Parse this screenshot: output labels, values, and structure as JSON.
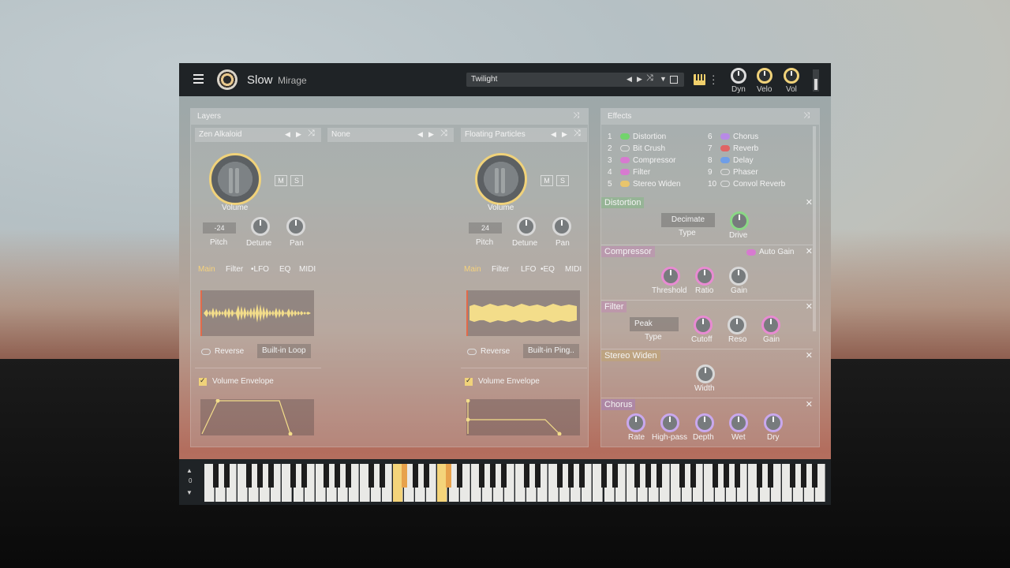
{
  "header": {
    "title": "Slow",
    "subtitle": "Mirage",
    "preset": "Twilight",
    "knobs": [
      {
        "label": "Dyn"
      },
      {
        "label": "Velo"
      },
      {
        "label": "Vol"
      }
    ]
  },
  "layers_panel": {
    "title": "Layers",
    "layers": [
      {
        "name": "Zen Alkaloid",
        "volume_label": "Volume",
        "mute": "M",
        "solo": "S",
        "pitch_value": "-24",
        "pitch_label": "Pitch",
        "detune_label": "Detune",
        "pan_label": "Pan",
        "tabs": [
          "Main",
          "Filter",
          "•LFO",
          "EQ",
          "MIDI"
        ],
        "reverse_label": "Reverse",
        "loop_mode": "Built-in Loop",
        "envelope_label": "Volume Envelope"
      },
      {
        "name": "None"
      },
      {
        "name": "Floating Particles",
        "volume_label": "Volume",
        "mute": "M",
        "solo": "S",
        "pitch_value": "24",
        "pitch_label": "Pitch",
        "detune_label": "Detune",
        "pan_label": "Pan",
        "tabs": [
          "Main",
          "Filter",
          "LFO",
          "•EQ",
          "MIDI"
        ],
        "reverse_label": "Reverse",
        "loop_mode": "Built-in Ping..",
        "envelope_label": "Volume Envelope"
      }
    ]
  },
  "effects_panel": {
    "title": "Effects",
    "list_left": [
      {
        "num": "1",
        "name": "Distortion",
        "color": "#72d46c",
        "on": true
      },
      {
        "num": "2",
        "name": "Bit Crush",
        "color": "#dddddd",
        "on": false
      },
      {
        "num": "3",
        "name": "Compressor",
        "color": "#d77ad0",
        "on": true
      },
      {
        "num": "4",
        "name": "Filter",
        "color": "#d77ad0",
        "on": true
      },
      {
        "num": "5",
        "name": "Stereo Widen",
        "color": "#e9c56c",
        "on": true
      }
    ],
    "list_right": [
      {
        "num": "6",
        "name": "Chorus",
        "color": "#b88ae6",
        "on": true
      },
      {
        "num": "7",
        "name": "Reverb",
        "color": "#e06464",
        "on": true
      },
      {
        "num": "8",
        "name": "Delay",
        "color": "#6f9ee8",
        "on": true
      },
      {
        "num": "9",
        "name": "Phaser",
        "color": "#dddddd",
        "on": false
      },
      {
        "num": "10",
        "name": "Convol Reverb",
        "color": "#dddddd",
        "on": false
      }
    ],
    "distortion": {
      "title": "Distortion",
      "type_value": "Decimate",
      "type_label": "Type",
      "drive_label": "Drive"
    },
    "compressor": {
      "title": "Compressor",
      "auto_gain": "Auto Gain",
      "threshold_label": "Threshold",
      "ratio_label": "Ratio",
      "gain_label": "Gain"
    },
    "filter": {
      "title": "Filter",
      "type_value": "Peak",
      "type_label": "Type",
      "cutoff_label": "Cutoff",
      "reso_label": "Reso",
      "gain_label": "Gain"
    },
    "stereo_widen": {
      "title": "Stereo Widen",
      "width_label": "Width"
    },
    "chorus": {
      "title": "Chorus",
      "rate_label": "Rate",
      "highpass_label": "High-pass",
      "depth_label": "Depth",
      "wet_label": "Wet",
      "dry_label": "Dry"
    }
  },
  "keyboard": {
    "octave_value": "0",
    "highlight_color": "#f4d47a"
  }
}
